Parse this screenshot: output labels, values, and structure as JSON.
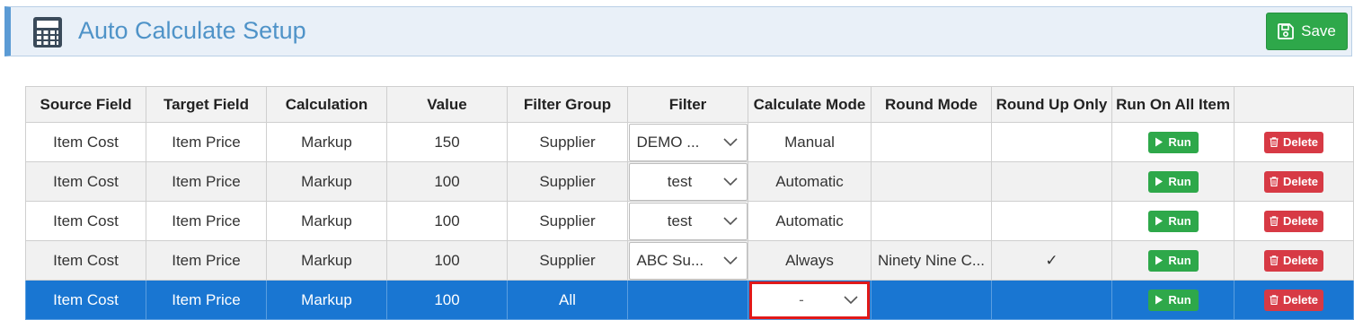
{
  "header": {
    "title": "Auto Calculate Setup",
    "save_label": "Save",
    "icon": "calculator-icon"
  },
  "table": {
    "columns": [
      "Source Field",
      "Target Field",
      "Calculation",
      "Value",
      "Filter Group",
      "Filter",
      "Calculate Mode",
      "Round Mode",
      "Round Up Only",
      "Run On All Item",
      ""
    ],
    "run_label": "Run",
    "delete_label": "Delete",
    "rows": [
      {
        "source": "Item Cost",
        "target": "Item Price",
        "calculation": "Markup",
        "value": "150",
        "filter_group": "Supplier",
        "filter": "DEMO ...",
        "calc_mode": "Manual",
        "round_mode": "",
        "round_up_only": ""
      },
      {
        "source": "Item Cost",
        "target": "Item Price",
        "calculation": "Markup",
        "value": "100",
        "filter_group": "Supplier",
        "filter": "test",
        "calc_mode": "Automatic",
        "round_mode": "",
        "round_up_only": ""
      },
      {
        "source": "Item Cost",
        "target": "Item Price",
        "calculation": "Markup",
        "value": "100",
        "filter_group": "Supplier",
        "filter": "test",
        "calc_mode": "Automatic",
        "round_mode": "",
        "round_up_only": ""
      },
      {
        "source": "Item Cost",
        "target": "Item Price",
        "calculation": "Markup",
        "value": "100",
        "filter_group": "Supplier",
        "filter": "ABC Su...",
        "calc_mode": "Always",
        "round_mode": "Ninety Nine C...",
        "round_up_only": "✓"
      },
      {
        "source": "Item Cost",
        "target": "Item Price",
        "calculation": "Markup",
        "value": "100",
        "filter_group": "All",
        "filter": "",
        "calc_mode": "-",
        "round_mode": "",
        "round_up_only": ""
      }
    ]
  },
  "colors": {
    "accent": "#5b9bd5",
    "title": "#4f93c8",
    "save": "#2ea84a",
    "run": "#2ea84a",
    "delete": "#d73a45",
    "selected_row": "#1976d2",
    "highlight_border": "#e11919"
  }
}
